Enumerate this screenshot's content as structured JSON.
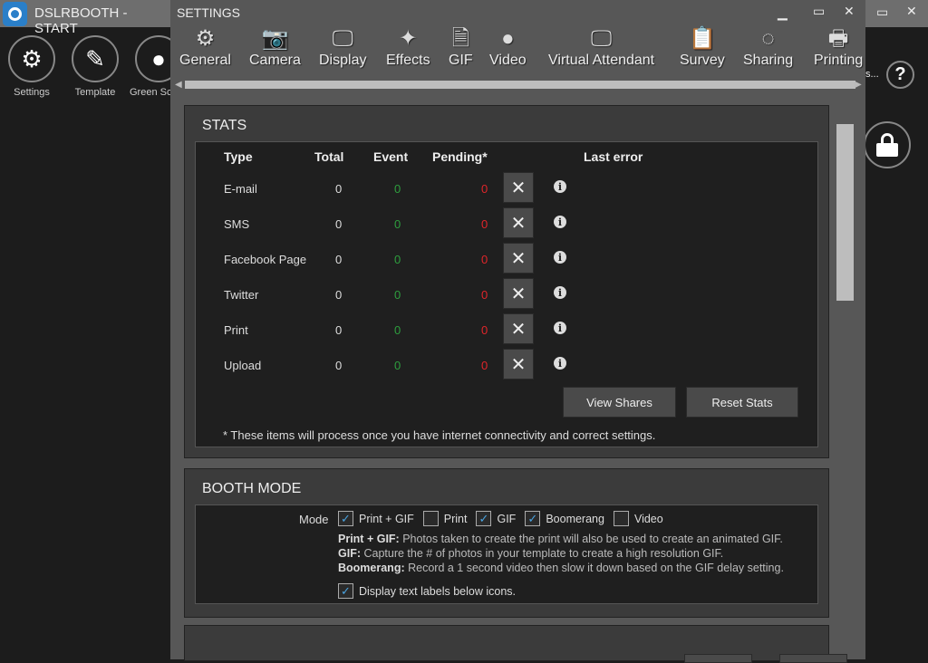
{
  "main_window": {
    "title": "DSLRBOOTH - START",
    "toolbar": [
      {
        "label": "Settings",
        "icon": "gear-icon"
      },
      {
        "label": "Template",
        "icon": "template-edit-icon"
      },
      {
        "label": "Green Sc",
        "icon": "person-icon"
      }
    ],
    "truncated_label": "s...",
    "help_icon": "?",
    "lock_icon": "lock-icon"
  },
  "dialog": {
    "title": "SETTINGS",
    "tabs": [
      {
        "label": "General",
        "icon": "⚙"
      },
      {
        "label": "Camera",
        "icon": "📷"
      },
      {
        "label": "Display",
        "icon": "🖵"
      },
      {
        "label": "Effects",
        "icon": "✦"
      },
      {
        "label": "GIF",
        "icon": "🗎"
      },
      {
        "label": "Video",
        "icon": "●"
      },
      {
        "label": "Virtual Attendant",
        "icon": "🖵"
      },
      {
        "label": "Survey",
        "icon": "📋"
      },
      {
        "label": "Sharing",
        "icon": "◌"
      },
      {
        "label": "Printing",
        "icon": "🖶"
      }
    ],
    "stats": {
      "heading": "STATS",
      "columns": [
        "Type",
        "Total",
        "Event",
        "Pending*",
        "Last error"
      ],
      "rows": [
        {
          "type": "E-mail",
          "total": "0",
          "event": "0",
          "pending": "0"
        },
        {
          "type": "SMS",
          "total": "0",
          "event": "0",
          "pending": "0"
        },
        {
          "type": "Facebook Page",
          "total": "0",
          "event": "0",
          "pending": "0"
        },
        {
          "type": "Twitter",
          "total": "0",
          "event": "0",
          "pending": "0"
        },
        {
          "type": "Print",
          "total": "0",
          "event": "0",
          "pending": "0"
        },
        {
          "type": "Upload",
          "total": "0",
          "event": "0",
          "pending": "0"
        }
      ],
      "view_shares": "View Shares",
      "reset_stats": "Reset Stats",
      "footnote": "* These items will process once you have internet connectivity and correct settings."
    },
    "booth_mode": {
      "heading": "BOOTH MODE",
      "mode_label": "Mode",
      "options": [
        {
          "label": "Print + GIF",
          "checked": true
        },
        {
          "label": "Print",
          "checked": false
        },
        {
          "label": "GIF",
          "checked": true
        },
        {
          "label": "Boomerang",
          "checked": true
        },
        {
          "label": "Video",
          "checked": false
        }
      ],
      "desc": [
        {
          "term": "Print + GIF:",
          "text": " Photos taken to create the print will also be used to create an animated GIF."
        },
        {
          "term": "GIF:",
          "text": " Capture the # of photos in your template to create a high resolution GIF."
        },
        {
          "term": "Boomerang:",
          "text": " Record a 1 second video then slow it down based on the GIF delay setting."
        }
      ],
      "display_labels": {
        "label": "Display text labels below icons.",
        "checked": true
      }
    }
  },
  "colors": {
    "event": "#2e9e3e",
    "pending": "#e0252a",
    "check": "#4aa3df"
  }
}
